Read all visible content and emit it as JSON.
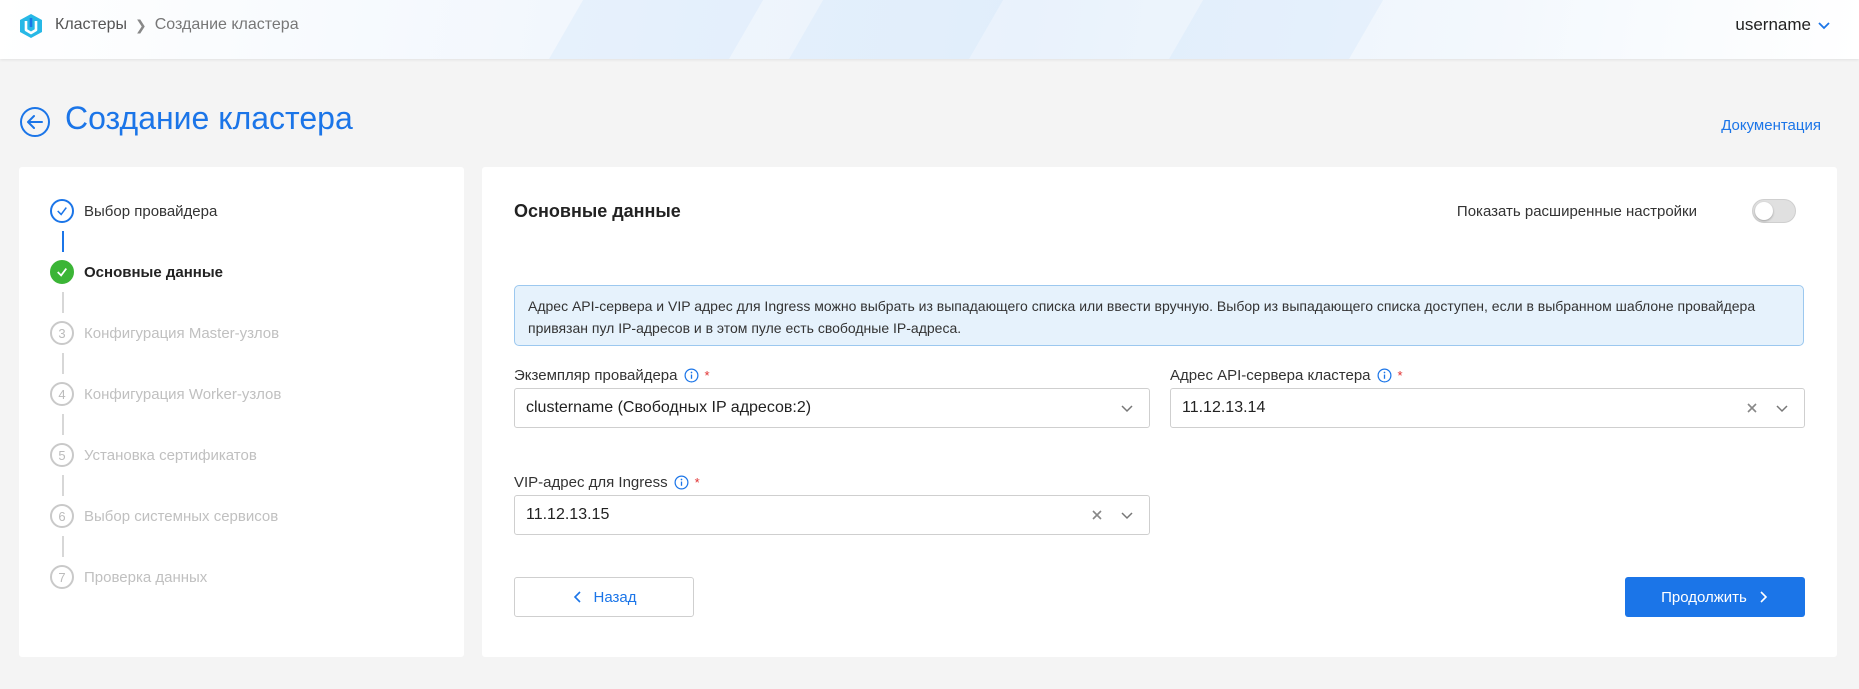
{
  "header": {
    "breadcrumbs": [
      "Кластеры",
      "Создание кластера"
    ],
    "username": "username"
  },
  "page": {
    "title": "Создание кластера",
    "docs_link": "Документация"
  },
  "stepper": {
    "steps": [
      {
        "number": "1",
        "label": "Выбор провайдера",
        "state": "done"
      },
      {
        "number": "2",
        "label": "Основные данные",
        "state": "active"
      },
      {
        "number": "3",
        "label": "Конфигурация Master-узлов",
        "state": "pending"
      },
      {
        "number": "4",
        "label": "Конфигурация Worker-узлов",
        "state": "pending"
      },
      {
        "number": "5",
        "label": "Установка сертификатов",
        "state": "pending"
      },
      {
        "number": "6",
        "label": "Выбор системных сервисов",
        "state": "pending"
      },
      {
        "number": "7",
        "label": "Проверка данных",
        "state": "pending"
      }
    ]
  },
  "form": {
    "section_title": "Основные данные",
    "advanced_label": "Показать расширенные настройки",
    "advanced_enabled": false,
    "info_text": "Адрес API-сервера и VIP адрес для Ingress можно выбрать из выпадающего списка или ввести вручную. Выбор из выпадающего списка доступен, если в выбранном шаблоне провайдера привязан пул IP-адресов и в этом пуле есть свободные IP-адреса.",
    "provider": {
      "label": "Экземпляр провайдера",
      "required_mark": "*",
      "value": "clustername (Свободных IP адресов:2)"
    },
    "api_address": {
      "label": "Адрес API-сервера кластера",
      "required_mark": "*",
      "value": "11.12.13.14"
    },
    "vip_address": {
      "label": "VIP-адрес для Ingress",
      "required_mark": "*",
      "value": "11.12.13.15"
    },
    "back_label": "Назад",
    "next_label": "Продолжить"
  },
  "colors": {
    "accent": "#1b75e8",
    "success": "#3bb536",
    "required": "#e03030"
  }
}
